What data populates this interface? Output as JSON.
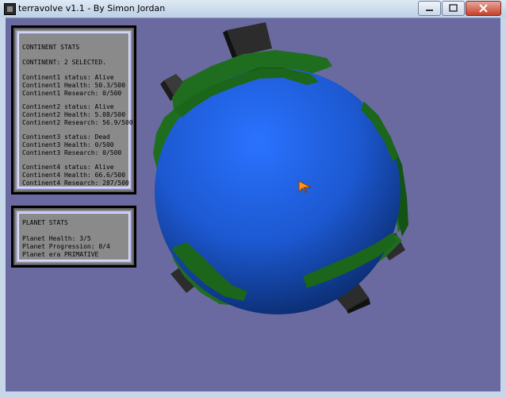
{
  "window": {
    "title": "terravolve v1.1 - By Simon Jordan",
    "minimize_icon": "minimize-icon",
    "maximize_icon": "maximize-icon",
    "close_icon": "close-icon"
  },
  "continent_stats": {
    "heading": "CONTINENT STATS",
    "selected": "CONTINENT: 2 SELECTED.",
    "continents": [
      {
        "status": "Continent1 status: Alive",
        "health": "Continent1 Health: 50.3/500",
        "research": "Continent1 Research: 0/500"
      },
      {
        "status": "Continent2 status: Alive",
        "health": "Continent2 Health: 5.08/500",
        "research": "Continent2 Research: 56.9/500"
      },
      {
        "status": "Continent3 status: Dead",
        "health": "Continent3 Health: 0/500",
        "research": "Continent3 Research: 0/500"
      },
      {
        "status": "Continent4 status: Alive",
        "health": "Continent4 Health: 66.6/500",
        "research": "Continent4 Research: 287/500"
      }
    ]
  },
  "planet_stats": {
    "heading": "PLANET STATS",
    "health": "Planet Health: 3/5",
    "progression": "Planet Progression: 0/4",
    "era": "Planet era PRIMATIVE"
  },
  "colors": {
    "background": "#6a6aa0",
    "ocean": "#1f5fd6",
    "continent": "#1f6e1f",
    "building": "#2a2a2a",
    "cursor": "#ff9a1a"
  }
}
